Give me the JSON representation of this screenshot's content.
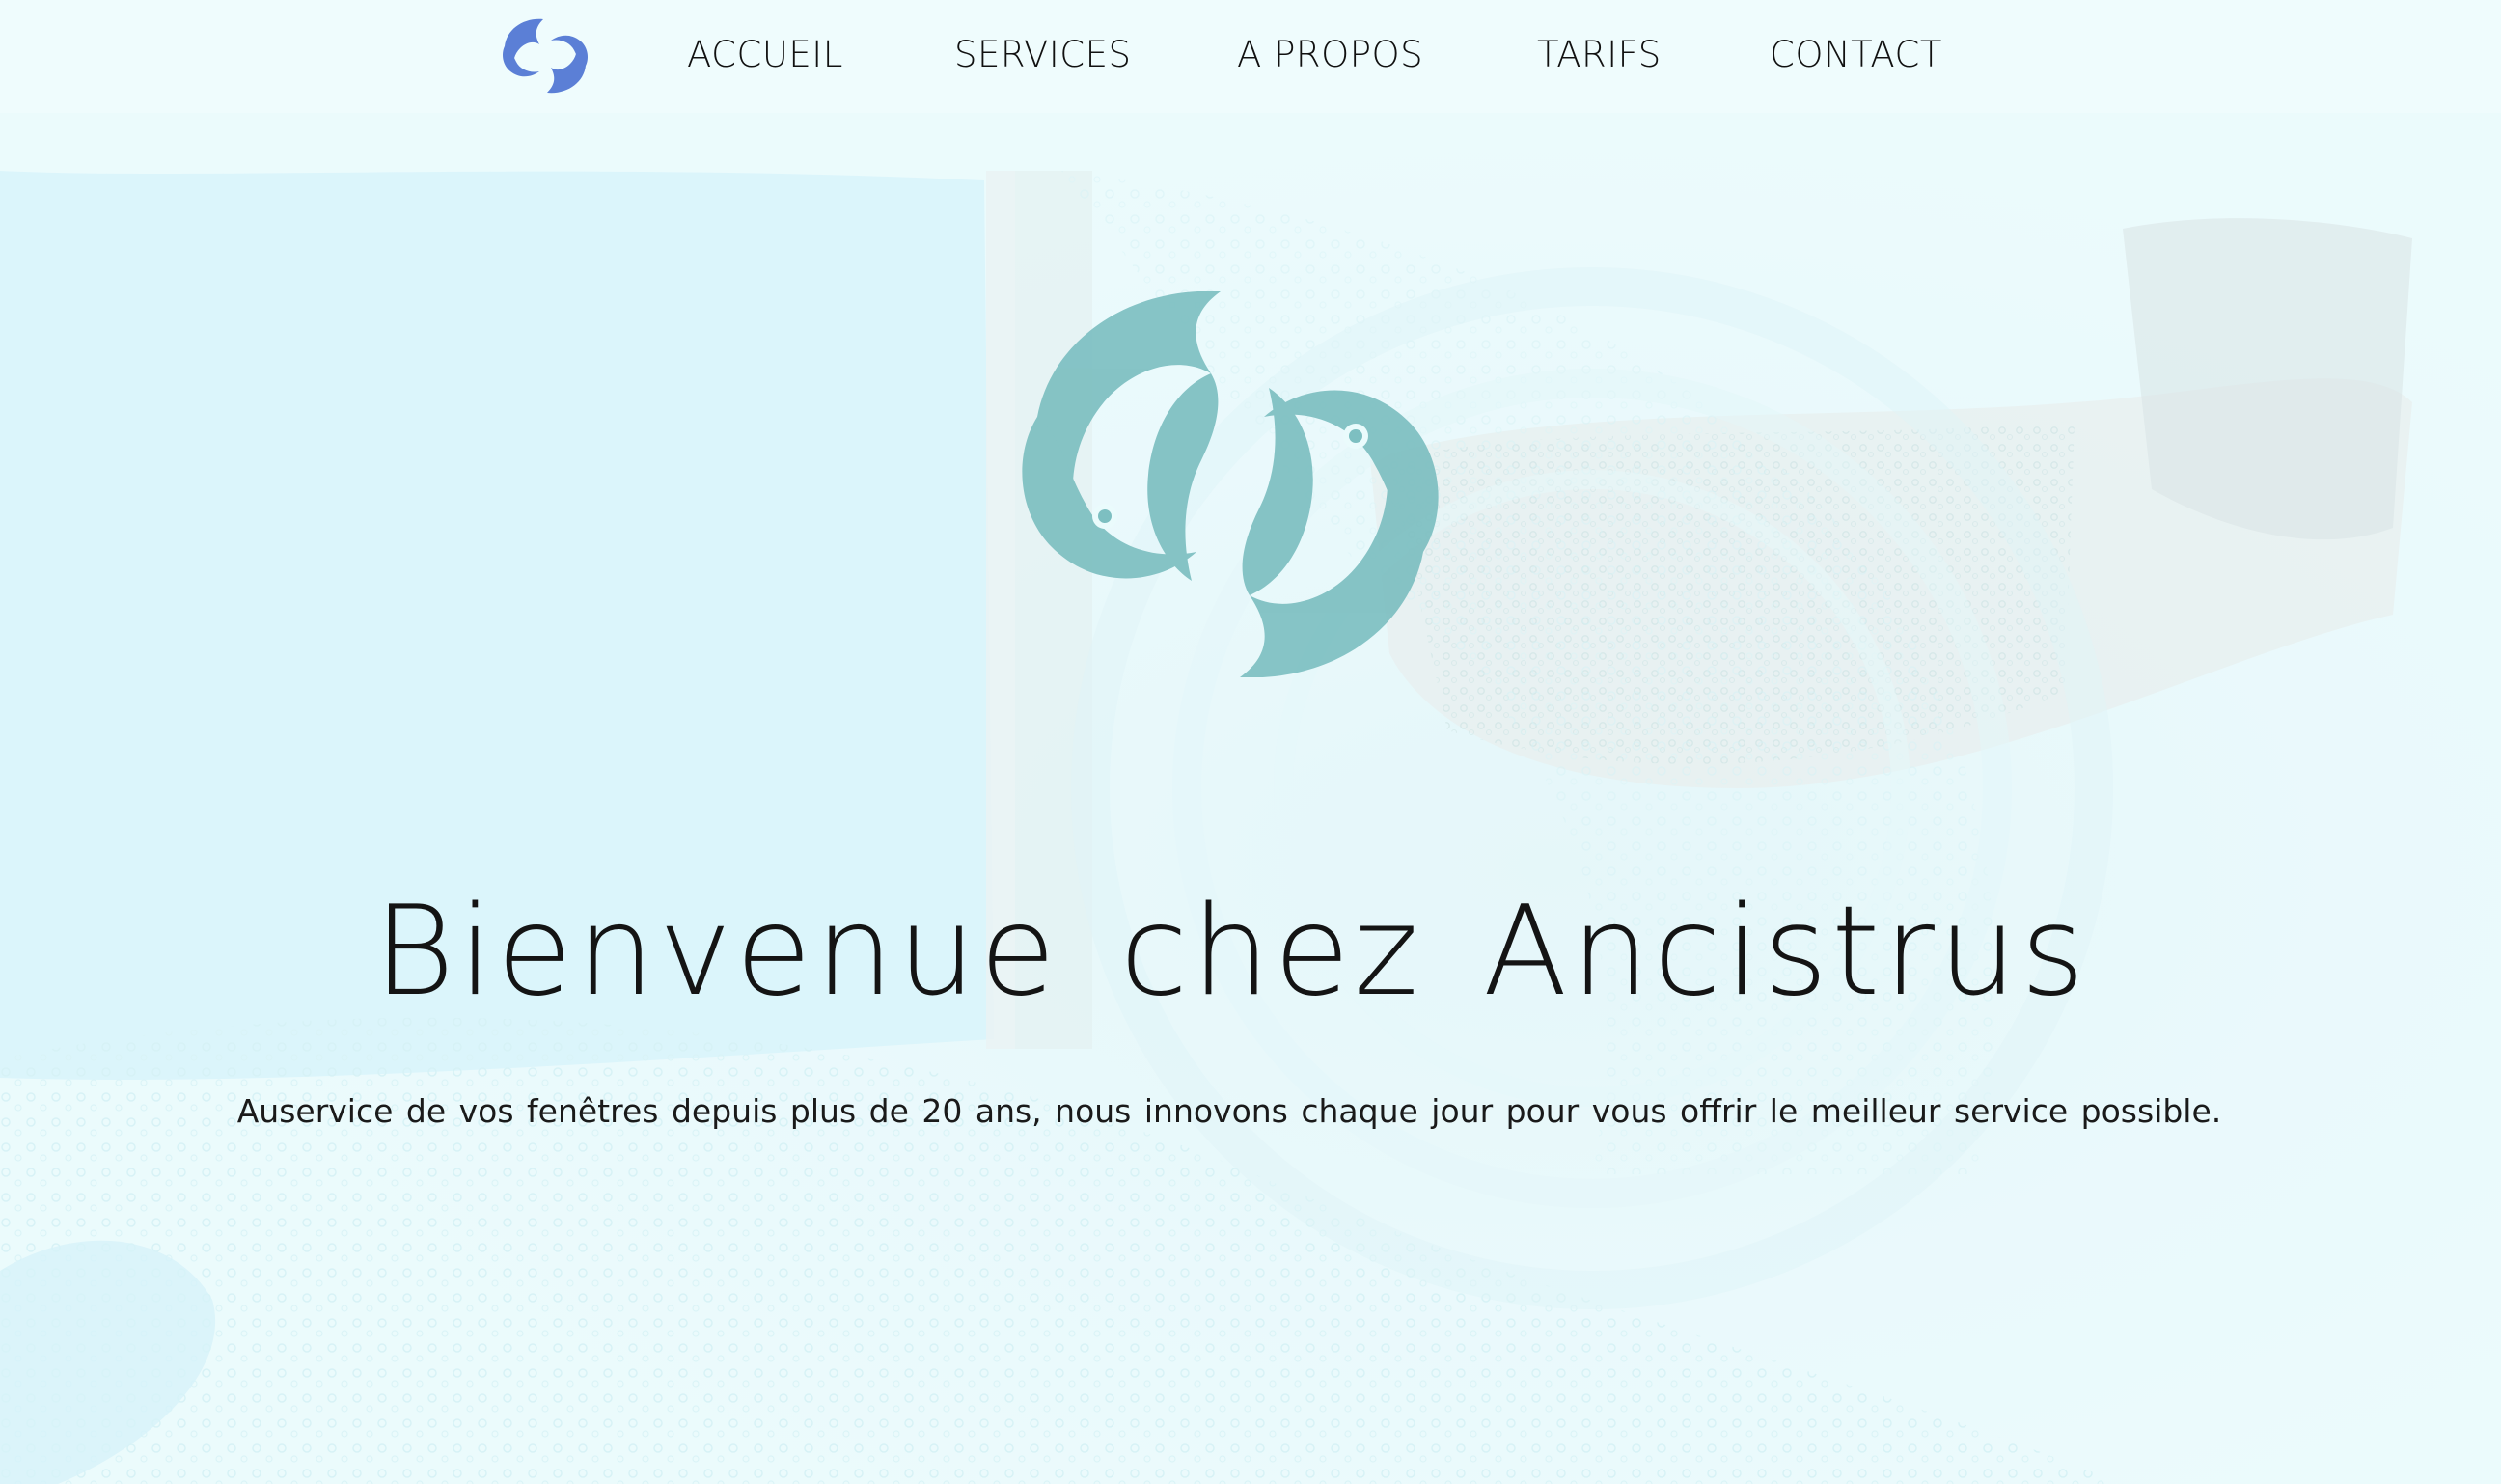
{
  "brand": {
    "logo_icon": "twin-fish-logo-icon",
    "logo_color": "#5b7fd6",
    "hero_logo_color": "#7dbfc1"
  },
  "nav": {
    "items": [
      {
        "label": "ACCUEIL"
      },
      {
        "label": "SERVICES"
      },
      {
        "label": "A PROPOS"
      },
      {
        "label": "TARIFS"
      },
      {
        "label": "CONTACT"
      }
    ]
  },
  "hero": {
    "title": "Bienvenue chez Ancistrus",
    "subtitle": "Auservice de vos fenêtres depuis plus de 20 ans, nous innovons chaque jour pour vous offrir le meilleur service possible.",
    "background": "soapy-window-cleaning-photo"
  },
  "colors": {
    "header_bg": "#effcfd",
    "text": "#111111"
  }
}
